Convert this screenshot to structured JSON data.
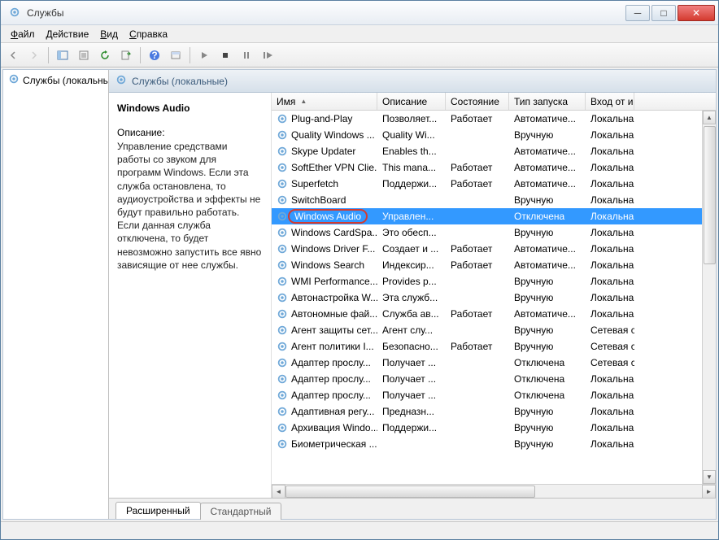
{
  "window": {
    "title": "Службы"
  },
  "menu": {
    "file": "Файл",
    "action": "Действие",
    "view": "Вид",
    "help": "Справка"
  },
  "tree": {
    "root": "Службы (локальные)"
  },
  "panel": {
    "header": "Службы (локальные)"
  },
  "detail": {
    "title": "Windows Audio",
    "desc_label": "Описание:",
    "desc": "Управление средствами работы со звуком для программ Windows. Если эта служба остановлена, то аудиоустройства и эффекты не будут правильно работать. Если данная служба отключена, то будет невозможно запустить все явно зависящие от нее службы."
  },
  "columns": {
    "name": "Имя",
    "desc": "Описание",
    "state": "Состояние",
    "start": "Тип запуска",
    "logon": "Вход от и"
  },
  "services": [
    {
      "name": "Plug-and-Play",
      "desc": "Позволяет...",
      "state": "Работает",
      "start": "Автоматиче...",
      "logon": "Локальна"
    },
    {
      "name": "Quality Windows ...",
      "desc": "Quality Wi...",
      "state": "",
      "start": "Вручную",
      "logon": "Локальна"
    },
    {
      "name": "Skype Updater",
      "desc": "Enables th...",
      "state": "",
      "start": "Автоматиче...",
      "logon": "Локальна"
    },
    {
      "name": "SoftEther VPN Clie...",
      "desc": "This mana...",
      "state": "Работает",
      "start": "Автоматиче...",
      "logon": "Локальна"
    },
    {
      "name": "Superfetch",
      "desc": "Поддержи...",
      "state": "Работает",
      "start": "Автоматиче...",
      "logon": "Локальна"
    },
    {
      "name": "SwitchBoard",
      "desc": "",
      "state": "",
      "start": "Вручную",
      "logon": "Локальна"
    },
    {
      "name": "Windows Audio",
      "desc": "Управлен...",
      "state": "",
      "start": "Отключена",
      "logon": "Локальна",
      "selected": true
    },
    {
      "name": "Windows CardSpa...",
      "desc": "Это обесп...",
      "state": "",
      "start": "Вручную",
      "logon": "Локальна"
    },
    {
      "name": "Windows Driver F...",
      "desc": "Создает и ...",
      "state": "Работает",
      "start": "Автоматиче...",
      "logon": "Локальна"
    },
    {
      "name": "Windows Search",
      "desc": "Индексир...",
      "state": "Работает",
      "start": "Автоматиче...",
      "logon": "Локальна"
    },
    {
      "name": "WMI Performance...",
      "desc": "Provides p...",
      "state": "",
      "start": "Вручную",
      "logon": "Локальна"
    },
    {
      "name": "Автонастройка W...",
      "desc": "Эта служб...",
      "state": "",
      "start": "Вручную",
      "logon": "Локальна"
    },
    {
      "name": "Автономные фай...",
      "desc": "Служба ав...",
      "state": "Работает",
      "start": "Автоматиче...",
      "logon": "Локальна"
    },
    {
      "name": "Агент защиты сет...",
      "desc": "Агент слу...",
      "state": "",
      "start": "Вручную",
      "logon": "Сетевая с"
    },
    {
      "name": "Агент политики I...",
      "desc": "Безопасно...",
      "state": "Работает",
      "start": "Вручную",
      "logon": "Сетевая с"
    },
    {
      "name": "Адаптер прослу...",
      "desc": "Получает ...",
      "state": "",
      "start": "Отключена",
      "logon": "Сетевая с"
    },
    {
      "name": "Адаптер прослу...",
      "desc": "Получает ...",
      "state": "",
      "start": "Отключена",
      "logon": "Локальна"
    },
    {
      "name": "Адаптер прослу...",
      "desc": "Получает ...",
      "state": "",
      "start": "Отключена",
      "logon": "Локальна"
    },
    {
      "name": "Адаптивная регу...",
      "desc": "Предназн...",
      "state": "",
      "start": "Вручную",
      "logon": "Локальна"
    },
    {
      "name": "Архивация Windo...",
      "desc": "Поддержи...",
      "state": "",
      "start": "Вручную",
      "logon": "Локальна"
    },
    {
      "name": "Биометрическая ...",
      "desc": "",
      "state": "",
      "start": "Вручную",
      "logon": "Локальна"
    }
  ],
  "tabs": {
    "extended": "Расширенный",
    "standard": "Стандартный"
  }
}
